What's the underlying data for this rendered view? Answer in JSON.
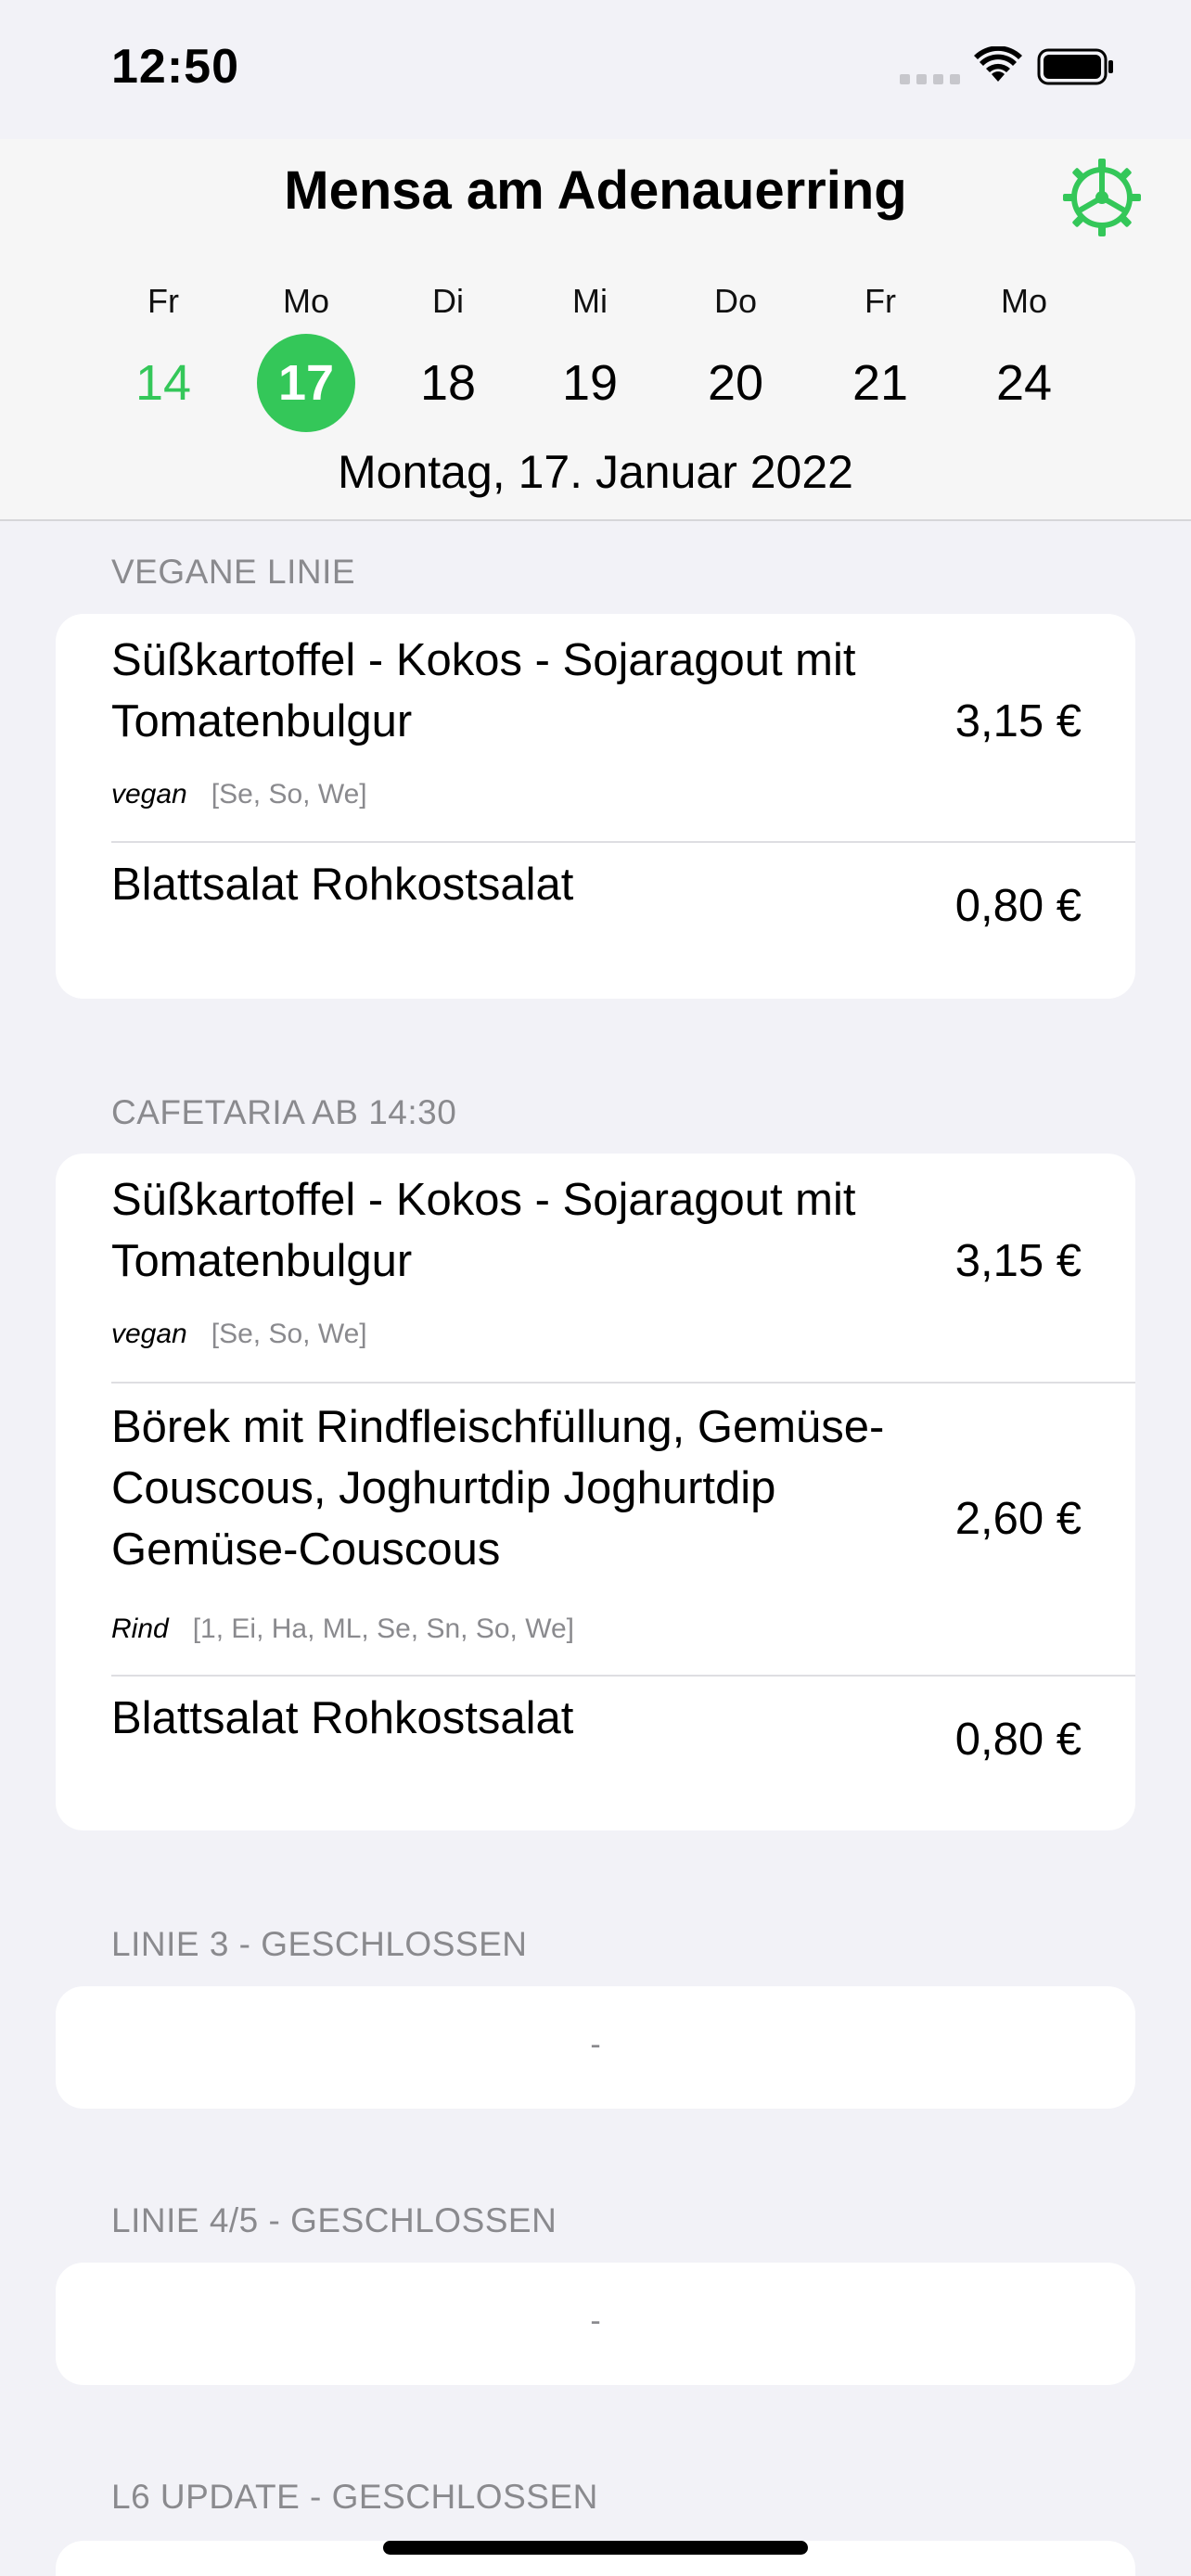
{
  "status_bar": {
    "time": "12:50",
    "icons": [
      "signal-icon",
      "wifi-icon",
      "battery-icon"
    ]
  },
  "header": {
    "title": "Mensa am Adenauerring",
    "settings_icon": "gear-icon",
    "accent_color": "#34c759",
    "days": [
      {
        "name": "Fr",
        "number": "14",
        "state": "past"
      },
      {
        "name": "Mo",
        "number": "17",
        "state": "selected"
      },
      {
        "name": "Di",
        "number": "18",
        "state": "future"
      },
      {
        "name": "Mi",
        "number": "19",
        "state": "future"
      },
      {
        "name": "Do",
        "number": "20",
        "state": "future"
      },
      {
        "name": "Fr",
        "number": "21",
        "state": "future"
      },
      {
        "name": "Mo",
        "number": "24",
        "state": "future"
      }
    ],
    "selected_date": "Montag, 17. Januar 2022"
  },
  "sections": [
    {
      "title": "VEGANE LINIE",
      "meals": [
        {
          "name": "Süßkartoffel - Kokos - Sojaragout mit Tomatenbulgur",
          "price": "3,15 €",
          "tag": "vegan",
          "allergens": "[Se, So, We]"
        },
        {
          "name": "Blattsalat Rohkostsalat",
          "price": "0,80 €",
          "tag": "",
          "allergens": ""
        }
      ]
    },
    {
      "title": "CAFETARIA AB 14:30",
      "meals": [
        {
          "name": "Süßkartoffel - Kokos - Sojaragout mit Tomatenbulgur",
          "price": "3,15 €",
          "tag": "vegan",
          "allergens": "[Se, So, We]"
        },
        {
          "name": "Börek mit Rindfleischfüllung, Gemüse-Couscous, Joghurtdip Joghurtdip Gemüse-Couscous",
          "price": "2,60 €",
          "tag": "Rind",
          "allergens": "[1, Ei, Ha, ML, Se, Sn, So, We]"
        },
        {
          "name": "Blattsalat Rohkostsalat",
          "price": "0,80 €",
          "tag": "",
          "allergens": ""
        }
      ]
    },
    {
      "title": "LINIE 3 - GESCHLOSSEN",
      "empty_text": "-"
    },
    {
      "title": "LINIE 4/5 - GESCHLOSSEN",
      "empty_text": "-"
    },
    {
      "title": "L6 UPDATE - GESCHLOSSEN"
    }
  ]
}
